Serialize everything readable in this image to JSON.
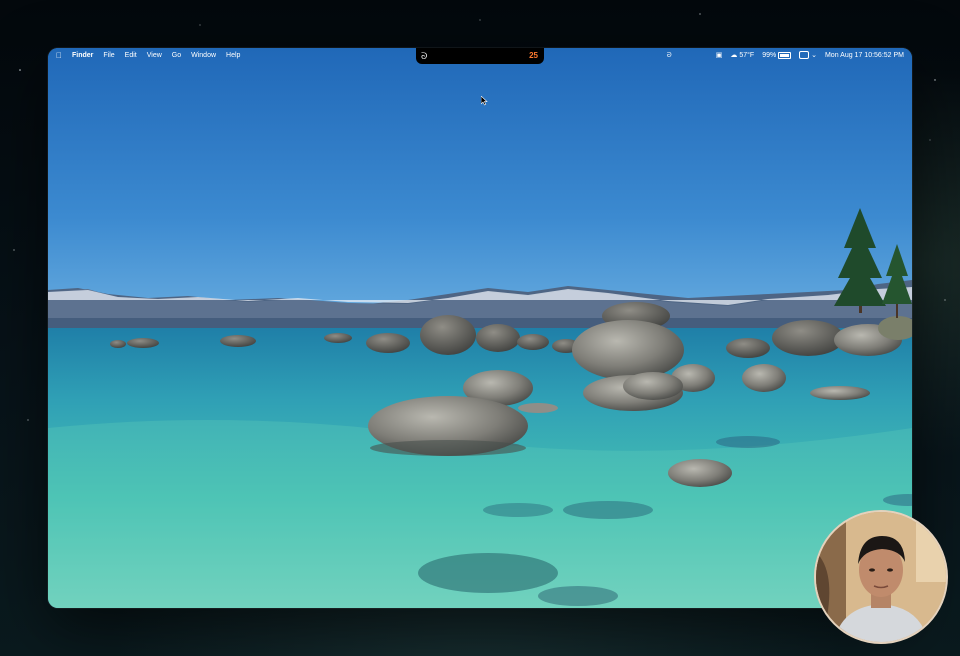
{
  "menubar": {
    "apple_icon": "apple-icon",
    "app_name": "Finder",
    "menus": [
      "File",
      "Edit",
      "View",
      "Go",
      "Window",
      "Help"
    ],
    "status": {
      "recorder_icon": "tracking-icon",
      "screen_icon": "screen-mirroring-icon",
      "weather": "57°F",
      "weather_icon": "cloud-icon",
      "battery_percent": "99%",
      "battery_level": 0.99,
      "control_center_icon": "control-center-icon",
      "date": "Mon Aug 17",
      "time": "10:56:52 PM"
    }
  },
  "notch": {
    "icon": "tracking-icon",
    "timer": "25"
  },
  "colors": {
    "sky_top": "#2070c0",
    "sky_bottom": "#5aa0d8",
    "water_turquoise": "#3cc2b0",
    "water_deep": "#1f6e9a",
    "timer_orange": "#ff7a2f"
  },
  "webcam": {
    "label": "presenter-webcam"
  }
}
